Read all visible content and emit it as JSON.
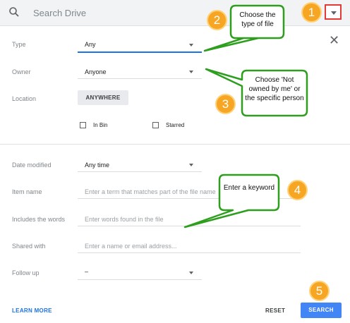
{
  "search": {
    "placeholder": "Search Drive"
  },
  "form": {
    "type": {
      "label": "Type",
      "value": "Any"
    },
    "owner": {
      "label": "Owner",
      "value": "Anyone"
    },
    "location": {
      "label": "Location",
      "button": "ANYWHERE"
    },
    "checkboxes": {
      "in_bin": "In Bin",
      "starred": "Starred"
    },
    "date_modified": {
      "label": "Date modified",
      "value": "Any time"
    },
    "item_name": {
      "label": "Item name",
      "placeholder": "Enter a term that matches part of the file name"
    },
    "includes_words": {
      "label": "Includes the words",
      "placeholder": "Enter words found in the file"
    },
    "shared_with": {
      "label": "Shared with",
      "placeholder": "Enter a name or email address..."
    },
    "follow_up": {
      "label": "Follow up",
      "value": "–"
    }
  },
  "footer": {
    "learn_more": "LEARN MORE",
    "reset": "RESET",
    "search": "SEARCH"
  },
  "annotations": {
    "badges": [
      "1",
      "2",
      "3",
      "4",
      "5"
    ],
    "callout_2": "Choose the type of file",
    "callout_3": "Choose 'Not owned by me' or the specific person",
    "callout_4": "Enter a keyword"
  },
  "colors": {
    "accent": "#4285f4",
    "badge": "#f6a623",
    "callout_border": "#2e9e1f",
    "highlight": "#e53935"
  }
}
